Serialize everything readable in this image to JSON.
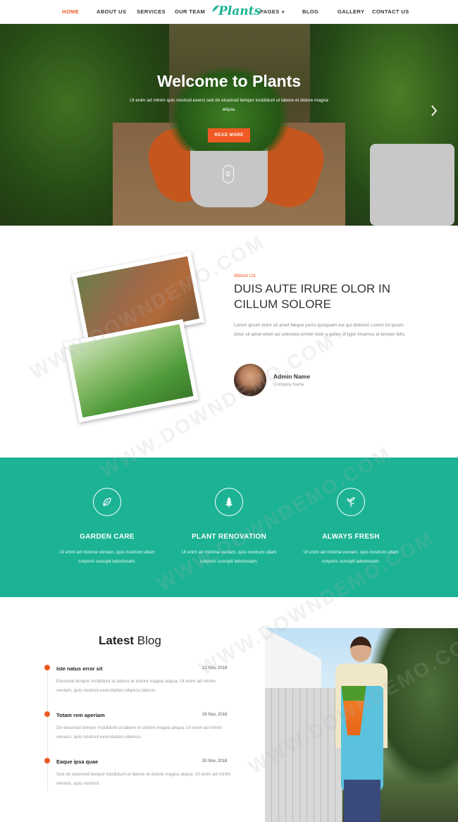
{
  "nav": {
    "items": [
      {
        "label": "HOME"
      },
      {
        "label": "ABOUT US"
      },
      {
        "label": "SERVICES"
      },
      {
        "label": "OUR TEAM"
      },
      {
        "label": "PAGES"
      },
      {
        "label": "BLOG"
      },
      {
        "label": "GALLERY"
      },
      {
        "label": "CONTACT US"
      }
    ],
    "logo": "Plants",
    "active_color": "#ef5a24"
  },
  "hero": {
    "title": "Welcome to Plants",
    "subtitle": "Ut enim ad minim quis nostrud exerci sed do eiusmod tempor incididunt ut labore et dolore magna aliqua.",
    "button": "READ MORE"
  },
  "about": {
    "kicker": "About Us",
    "title": "DUIS AUTE IRURE OLOR IN CILLUM SOLORE",
    "text": "Lorem ipsum dolor sit amet Neque porro quisquam est qui dolorem Lorem int ipsum dolor sit amet when an unknown printer took a galley of type Vivamus id tempor felis.",
    "admin_name": "Admin Name",
    "company": "Company Name"
  },
  "features": {
    "bg_color": "#1bb394",
    "items": [
      {
        "icon": "leaf-icon",
        "title": "GARDEN CARE",
        "text": "Ut enim ad minima veniam, quis nostrum ullam corporis suscipit laboriosam."
      },
      {
        "icon": "pine-tree-icon",
        "title": "PLANT RENOVATION",
        "text": "Ut enim ad minima veniam, quis nostrum ullam corporis suscipit laboriosam."
      },
      {
        "icon": "sprout-icon",
        "title": "ALWAYS FRESH",
        "text": "Ut enim ad minima veniam, quis nostrum ullam corporis suscipit laboriosam."
      }
    ]
  },
  "blog": {
    "title_bold": "Latest",
    "title_rest": " Blog",
    "posts": [
      {
        "title": "Iste natus error sit",
        "date": "21 Nov, 2018",
        "text": "Eiusmod tempor incididunt ut labore et dolore magna aliqua. Ut enim ad minim veniam, quis nostrud exercitation ullamco laboris."
      },
      {
        "title": "Totam rem aperiam",
        "date": "26 Nov, 2018",
        "text": "Do eiusmod tempor incididunt ut labore et dolore magna aliqua. Ut enim ad minim veniam, quis nostrud exercitation ullamco."
      },
      {
        "title": "Eaque ipsa quae",
        "date": "30 Nov, 2018",
        "text": "Sed do eiusmod tempor incididunt ut labore et dolore magna aliqua. Ut enim ad minim veniam, quis nostrud."
      }
    ]
  },
  "watermark": "WWW.DOWNDEMO.COM"
}
